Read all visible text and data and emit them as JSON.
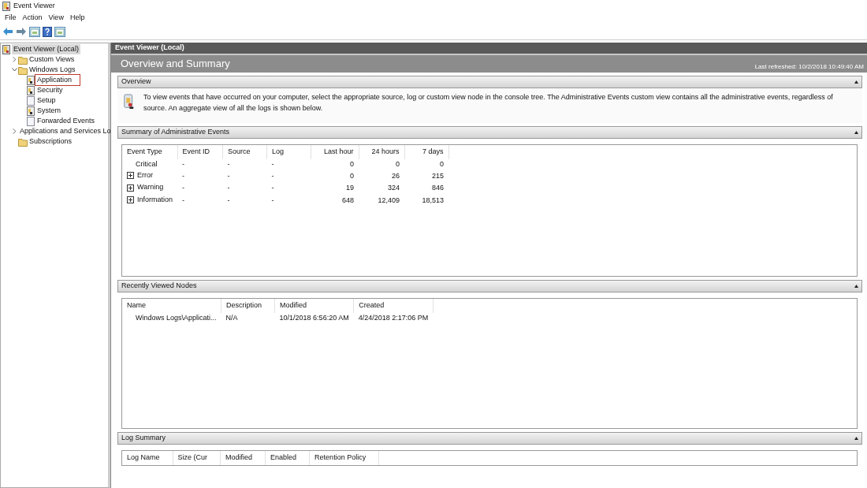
{
  "window": {
    "title": "Event Viewer"
  },
  "menu": [
    "File",
    "Action",
    "View",
    "Help"
  ],
  "toolbar": [
    {
      "kind": "back"
    },
    {
      "kind": "forward"
    },
    {
      "kind": "panel"
    },
    {
      "kind": "help"
    },
    {
      "kind": "panel"
    }
  ],
  "tree": [
    {
      "label": "Event Viewer (Local)",
      "kind": "root",
      "selected": true,
      "outlined": false,
      "children": [
        {
          "label": "Custom Views",
          "kind": "folder",
          "expanded": false,
          "selected": false,
          "outlined": false
        },
        {
          "label": "Windows Logs",
          "kind": "folder",
          "expanded": true,
          "selected": false,
          "outlined": false,
          "children": [
            {
              "label": "Application",
              "kind": "log",
              "selected": false,
              "outlined": true
            },
            {
              "label": "Security",
              "kind": "log",
              "selected": false,
              "outlined": false
            },
            {
              "label": "Setup",
              "kind": "page",
              "selected": false,
              "outlined": false
            },
            {
              "label": "System",
              "kind": "log",
              "selected": false,
              "outlined": false
            },
            {
              "label": "Forwarded Events",
              "kind": "page",
              "selected": false,
              "outlined": false
            }
          ]
        },
        {
          "label": "Applications and Services Lo",
          "kind": "folder",
          "expanded": false,
          "selected": false,
          "outlined": false
        },
        {
          "label": "Subscriptions",
          "kind": "folder",
          "selected": false,
          "outlined": false
        }
      ]
    }
  ],
  "main": {
    "header": "Event Viewer (Local)",
    "title": "Overview and Summary",
    "last_refreshed": "Last refreshed: 10/2/2018 10:49:40 AM",
    "sections": [
      {
        "kind": "text",
        "title": "Overview",
        "text": "To view events that have occurred on your computer, select the appropriate source, log or custom view node in the console tree. The Administrative Events custom view contains all the administrative events, regardless of source. An aggregate view of all the logs is shown below."
      },
      {
        "kind": "table",
        "title": "Summary of Administrative Events",
        "columns": [
          {
            "label": "Event Type",
            "numeric": false
          },
          {
            "label": "Event ID",
            "numeric": false
          },
          {
            "label": "Source",
            "numeric": false
          },
          {
            "label": "Log",
            "numeric": false
          },
          {
            "label": "Last hour",
            "numeric": true
          },
          {
            "label": "24 hours",
            "numeric": true
          },
          {
            "label": "7 days",
            "numeric": true
          }
        ],
        "rows": [
          {
            "expandable": false,
            "cells": [
              "Critical",
              "-",
              "-",
              "-",
              "0",
              "0",
              "0"
            ]
          },
          {
            "expandable": true,
            "cells": [
              "Error",
              "-",
              "-",
              "-",
              "0",
              "26",
              "215"
            ]
          },
          {
            "expandable": true,
            "cells": [
              "Warning",
              "-",
              "-",
              "-",
              "19",
              "324",
              "846"
            ]
          },
          {
            "expandable": true,
            "cells": [
              "Information",
              "-",
              "-",
              "-",
              "648",
              "12,409",
              "18,513"
            ]
          }
        ]
      },
      {
        "kind": "table",
        "title": "Recently Viewed Nodes",
        "columns": [
          {
            "label": "Name",
            "numeric": false
          },
          {
            "label": "Description",
            "numeric": false
          },
          {
            "label": "Modified",
            "numeric": false
          },
          {
            "label": "Created",
            "numeric": false
          }
        ],
        "rows": [
          {
            "expandable": false,
            "cells": [
              "Windows Logs\\Applicati...",
              "N/A",
              "10/1/2018 6:56:20 AM",
              "4/24/2018 2:17:06 PM"
            ]
          }
        ]
      },
      {
        "kind": "table",
        "title": "Log Summary",
        "columns": [
          {
            "label": "Log Name",
            "numeric": false
          },
          {
            "label": "Size (Cur",
            "numeric": false
          },
          {
            "label": "Modified",
            "numeric": false
          },
          {
            "label": "Enabled",
            "numeric": false
          },
          {
            "label": "Retention Policy",
            "numeric": false
          }
        ]
      }
    ]
  }
}
